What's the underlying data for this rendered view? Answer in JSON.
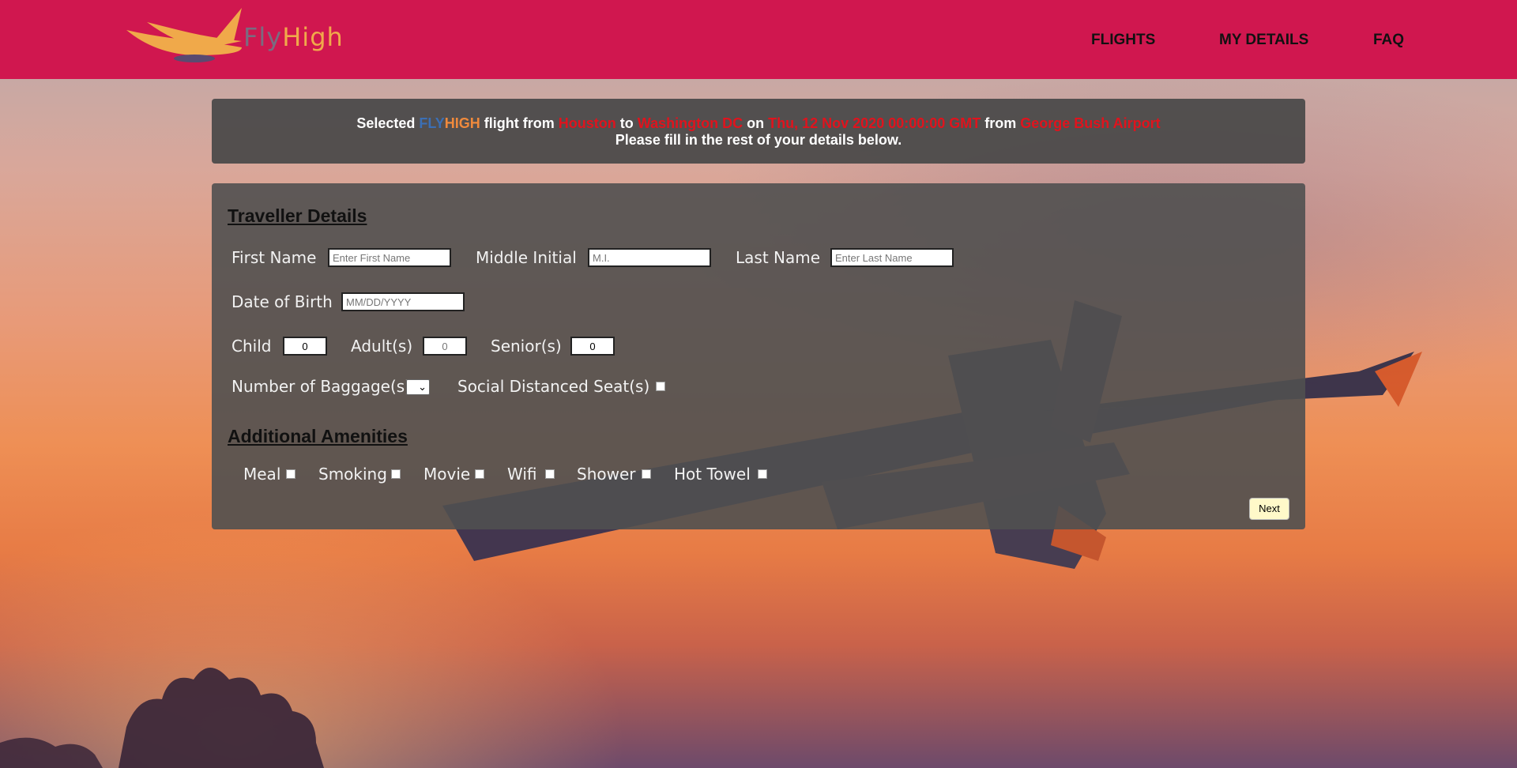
{
  "header": {
    "brand": {
      "part1": "Fly",
      "part2": "High"
    },
    "nav": [
      {
        "label": "FLIGHTS"
      },
      {
        "label": "MY DETAILS"
      },
      {
        "label": "FAQ"
      }
    ]
  },
  "banner": {
    "w_selected": "Selected",
    "brand_fly": "FLY",
    "brand_high": "HIGH",
    "w_flight_from": "flight from",
    "origin": "Houston",
    "w_to": "to",
    "destination": "Washington DC",
    "w_on": "on",
    "date": "Thu, 12 Nov 2020 00:00:00 GMT",
    "w_from": "from",
    "airport": "George Bush Airport",
    "line2": "Please fill in the rest of your details below."
  },
  "traveller": {
    "title": "Traveller Details",
    "first_name": {
      "label": "First Name",
      "placeholder": "Enter First Name",
      "value": ""
    },
    "middle_initial": {
      "label": "Middle Initial",
      "placeholder": "M.I.",
      "value": ""
    },
    "last_name": {
      "label": "Last Name",
      "placeholder": "Enter Last Name",
      "value": ""
    },
    "dob": {
      "label": "Date of Birth",
      "placeholder": "MM/DD/YYYY",
      "value": ""
    },
    "child": {
      "label": "Child",
      "value": "0"
    },
    "adults": {
      "label": "Adult(s)",
      "placeholder": "0",
      "value": ""
    },
    "seniors": {
      "label": "Senior(s)",
      "value": "0"
    },
    "baggage": {
      "label": "Number of Baggage(s)",
      "selected": ""
    },
    "social_distance": {
      "label": "Social Distanced Seat(s)",
      "checked": false
    }
  },
  "amenities": {
    "title": "Additional Amenities",
    "items": [
      {
        "label": "Meal",
        "checked": false
      },
      {
        "label": "Smoking",
        "checked": false
      },
      {
        "label": "Movie",
        "checked": false
      },
      {
        "label": "Wifi",
        "checked": false
      },
      {
        "label": "Shower",
        "checked": false
      },
      {
        "label": "Hot Towel",
        "checked": false
      }
    ]
  },
  "actions": {
    "next_label": "Next"
  },
  "colors": {
    "header_bg": "#d0174f",
    "panel_bg": "#4a4a4a",
    "highlight_red": "#e0131d",
    "brand_blue": "#3b6fb5",
    "brand_orange": "#f08a3c",
    "next_button_bg": "#fff9c9"
  }
}
